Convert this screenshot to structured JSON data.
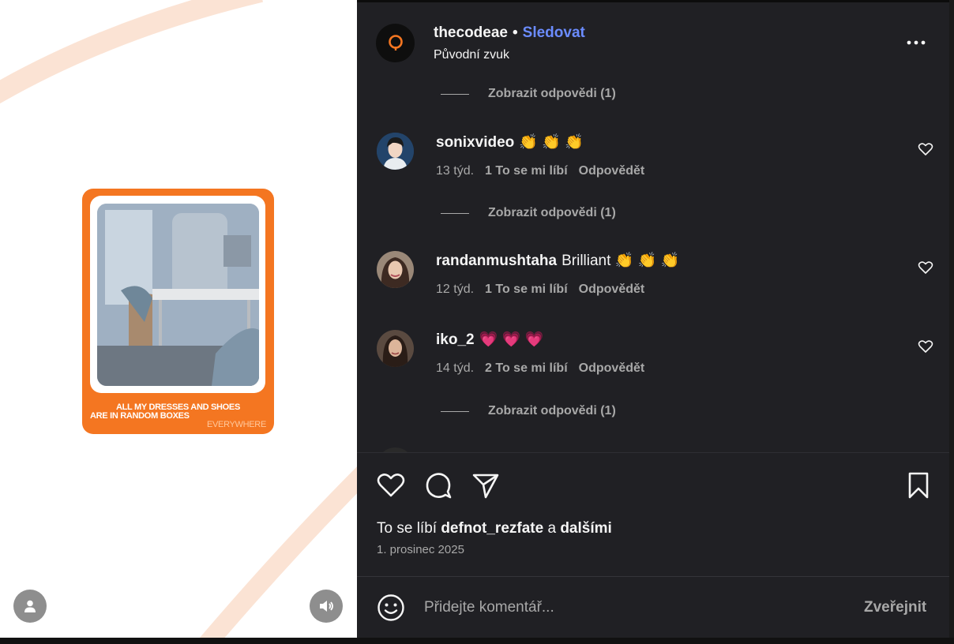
{
  "post": {
    "username": "thecodeae",
    "follow_label": "Sledovat",
    "audio": "Původní zvuk",
    "card_caption": {
      "line1": "ALL MY DRESSES AND SHOES",
      "line2": "ARE IN RANDOM BOXES",
      "line3": "EVERYWHERE"
    }
  },
  "comments": {
    "view_replies_label": "Zobrazit odpovědi (1)",
    "items": [
      {
        "user": "sonixvideo",
        "text": "👏 👏 👏",
        "age": "13 týd.",
        "likes": "1 To se mi líbí",
        "reply": "Odpovědět"
      },
      {
        "user": "randanmushtaha",
        "text": "Brilliant 👏 👏 👏",
        "age": "12 týd.",
        "likes": "1 To se mi líbí",
        "reply": "Odpovědět"
      },
      {
        "user": "iko_2",
        "text": "💗 💗 💗",
        "age": "14 týd.",
        "likes": "2 To se mi líbí",
        "reply": "Odpovědět"
      }
    ]
  },
  "footer": {
    "liked_prefix": "To se líbí",
    "liked_user": "defnot_rezfate",
    "liked_and": "a",
    "liked_others": "dalšími",
    "date": "1. prosinec 2025"
  },
  "composer": {
    "placeholder": "Přidejte komentář...",
    "post_label": "Zveřejnit"
  },
  "colors": {
    "accent": "#6b8cff",
    "brand_orange": "#f47621",
    "panel_bg": "#202024"
  },
  "icons": [
    "user-icon",
    "volume-icon",
    "more-icon",
    "heart-icon",
    "comment-icon",
    "share-icon",
    "bookmark-icon",
    "emoji-icon"
  ]
}
